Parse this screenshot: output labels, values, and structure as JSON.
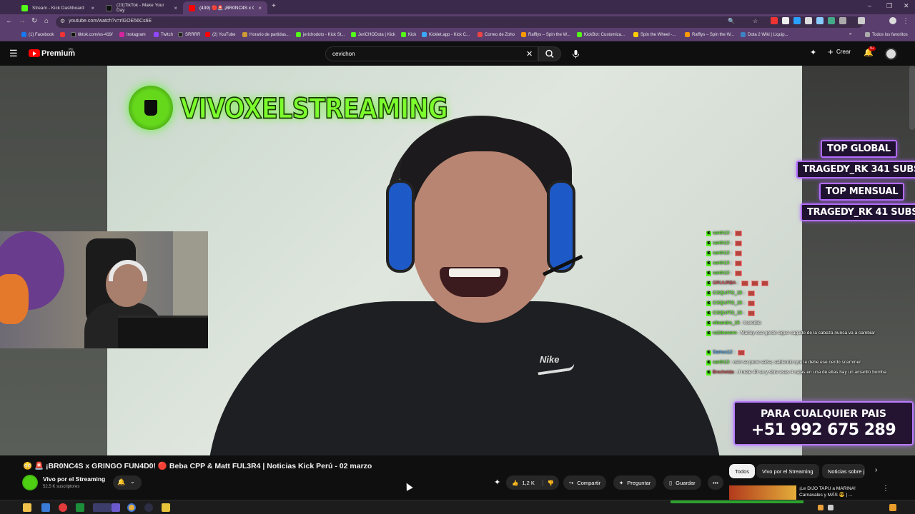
{
  "browser": {
    "tabs": [
      {
        "title": "Stream - Kick Dashboard",
        "color": "#53fc18"
      },
      {
        "title": "(23)TikTok - Make Your Day",
        "color": "#111111"
      },
      {
        "title": "(439) 🔴🚨 ¡BR0NC4S x GI",
        "color": "#ff0000"
      }
    ],
    "new_tab": "+",
    "url": "youtube.com/watch?v=rlGOE56Cs6E",
    "bookmarks": [
      {
        "label": "(1) Facebook",
        "color": "#1877f2"
      },
      {
        "label": "tiktok.com/es-419/",
        "color": "#111111"
      },
      {
        "label": "Instagram",
        "color": "#d6249f"
      },
      {
        "label": "Twitch",
        "color": "#9146ff"
      },
      {
        "label": "SRRRR",
        "color": "#222222"
      },
      {
        "label": "(2) YouTube",
        "color": "#ff0000"
      },
      {
        "label": "Horario de partidas...",
        "color": "#cc9933"
      },
      {
        "label": "jerichodoto - Kick St...",
        "color": "#53fc18"
      },
      {
        "label": "JeriCHODota | Kick",
        "color": "#53fc18"
      },
      {
        "label": "Kick",
        "color": "#53fc18"
      },
      {
        "label": "Kicklet.app - Kick C...",
        "color": "#3aa7ff"
      },
      {
        "label": "Correo de Zoho",
        "color": "#e44"
      },
      {
        "label": "Rafflys – Spin the W...",
        "color": "#ff9900"
      },
      {
        "label": "KickBot: Customiza...",
        "color": "#53fc18"
      },
      {
        "label": "Spin the Wheel -...",
        "color": "#ffcc00"
      },
      {
        "label": "Rafflys – Spin the W...",
        "color": "#ff9900"
      },
      {
        "label": "Dota 2 Wiki | Liquip...",
        "color": "#3c82c4"
      },
      {
        "label": "Todos los favoritos",
        "color": "#aaaaaa"
      }
    ]
  },
  "youtube": {
    "brand": "Premium",
    "country": "PE",
    "search_value": "cevichon",
    "create_label": "Crear",
    "notif_count": "9+"
  },
  "video": {
    "channel_overlay": "VIVOXELSTREAMING",
    "top_subs": [
      "TOP GLOBAL",
      "TRAGEDY_RK 341 SUBS",
      "TOP MENSUAL",
      "TRAGEDY_RK 41 SUBS"
    ],
    "nike": "Nike",
    "promo_line1": "PARA CUALQUIER PAIS",
    "promo_line2": "+51 992 675 289",
    "chat": [
      {
        "user": "santh13",
        "msg": ":"
      },
      {
        "user": "santh13",
        "msg": ":"
      },
      {
        "user": "santh13",
        "msg": ":"
      },
      {
        "user": "santh13",
        "msg": ":"
      },
      {
        "user": "santh13",
        "msg": ":"
      },
      {
        "user": "GRUURBA",
        "msg": ":"
      },
      {
        "user": "COQUITO_15",
        "msg": ":"
      },
      {
        "user": "COQUITO_15",
        "msg": ":"
      },
      {
        "user": "COQUITO_15",
        "msg": ":"
      },
      {
        "user": "elleandro_15",
        "msg": ": Increible"
      },
      {
        "user": "ra1kkonenn",
        "msg": ": Marley ese gordo sigue cagado de la cabeza nunca va a cambiar"
      },
      {
        "user": "Samus12",
        "msg": ":"
      },
      {
        "user": "santh13",
        "msg": ": csm se pone salsa, sabiendo que le debe ese cerdo scammer"
      },
      {
        "user": "Brechetda",
        "msg": ": J mete 40 so y sbre esas 4 cajas en una de ellas hay un amarillo bomba"
      }
    ]
  },
  "below": {
    "title": "😳 🚨 ¡BR0NC4S x GRINGO FUN4D0! 🔴 Beba CPP & Matt FUL3R4 | Noticias Kick Perú - 02 marzo",
    "channel": "Vivo por el Streaming",
    "subs": "52,5 K suscriptores",
    "likes": "1,2 K",
    "share": "Compartir",
    "ask": "Preguntar",
    "save": "Guardar",
    "chips": [
      "Todos",
      "Vivo por el Streaming",
      "Noticias sobre j"
    ],
    "rec_title": "¡Le DIJO TAPU a MARINA! Carnavales y MÁS 😎 | ..."
  }
}
